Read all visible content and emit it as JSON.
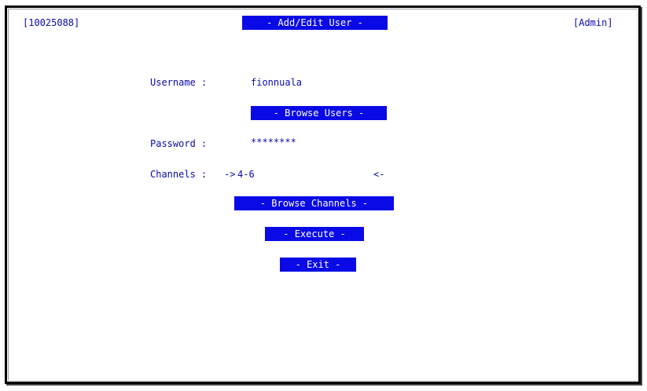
{
  "header": {
    "id_label": "[10025088]",
    "title": "- Add/Edit User -",
    "role_label": "[Admin]"
  },
  "form": {
    "username_label": "Username :",
    "username_value": "fionnuala",
    "browse_users": "- Browse Users -",
    "password_label": "Password :",
    "password_value": "********",
    "channels_label": "Channels :",
    "channels_prefix": "->",
    "channels_value": "4-6",
    "channels_suffix": "<-",
    "browse_channels": "- Browse Channels -",
    "execute": "- Execute -",
    "exit": "- Exit -"
  },
  "colors": {
    "text": "#0a0aa8",
    "button_bg": "#0a0ae6",
    "button_text": "#ffffff"
  }
}
